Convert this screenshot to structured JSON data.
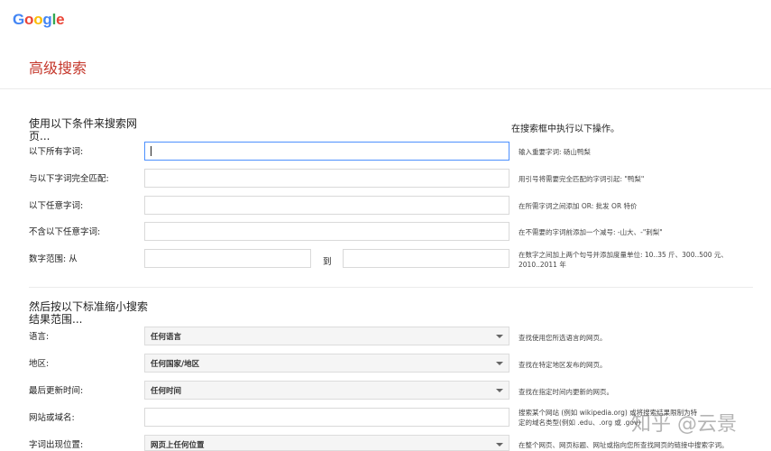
{
  "logo": {
    "letters": [
      {
        "char": "G",
        "color": "#4285f4"
      },
      {
        "char": "o",
        "color": "#ea4335"
      },
      {
        "char": "o",
        "color": "#fbbc05"
      },
      {
        "char": "g",
        "color": "#4285f4"
      },
      {
        "char": "l",
        "color": "#34a853"
      },
      {
        "char": "e",
        "color": "#ea4335"
      }
    ]
  },
  "page_title": "高级搜索",
  "section1": {
    "heading": "使用以下条件来搜索网页...",
    "right_heading": "在搜索框中执行以下操作。",
    "rows": [
      {
        "label": "以下所有字词:",
        "value": "",
        "hint": "输入重要字词: 砀山鸭梨"
      },
      {
        "label": "与以下字词完全匹配:",
        "value": "",
        "hint": "用引号将需要完全匹配的字词引起: \"鸭梨\""
      },
      {
        "label": "以下任意字词:",
        "value": "",
        "hint": "在所需字词之间添加 OR: 批发 OR 特价"
      },
      {
        "label": "不含以下任意字词:",
        "value": "",
        "hint": "在不需要的字词前添加一个减号: -山大、-\"刺梨\""
      }
    ],
    "range": {
      "label": "数字范围: 从",
      "separator": "到",
      "from_value": "",
      "to_value": "",
      "hint": "在数字之间加上两个句号并添加度量单位: 10..35 斤、300..500 元、2010..2011 年"
    }
  },
  "section2": {
    "heading": "然后按以下标准缩小搜索结果范围...",
    "rows": [
      {
        "label": "语言:",
        "value": "任何语言",
        "hint": "查找使用您所选语言的网页。"
      },
      {
        "label": "地区:",
        "value": "任何国家/地区",
        "hint": "查找在特定地区发布的网页。"
      },
      {
        "label": "最后更新时间:",
        "value": "任何时间",
        "hint": "查找在指定时间内更新的网页。"
      }
    ],
    "site": {
      "label": "网站或域名:",
      "value": "",
      "hint": "搜索某个网站 (例如 wikipedia.org) 或将搜索结果限制为特定的域名类型(例如 .edu、.org 或 .gov)"
    },
    "position": {
      "label": "字词出现位置:",
      "value": "网页上任何位置",
      "hint": "在整个网页、网页标题、网址或指向您所查找网页的链接中搜索字词。"
    }
  },
  "watermark": {
    "text": "知乎 @云景"
  }
}
